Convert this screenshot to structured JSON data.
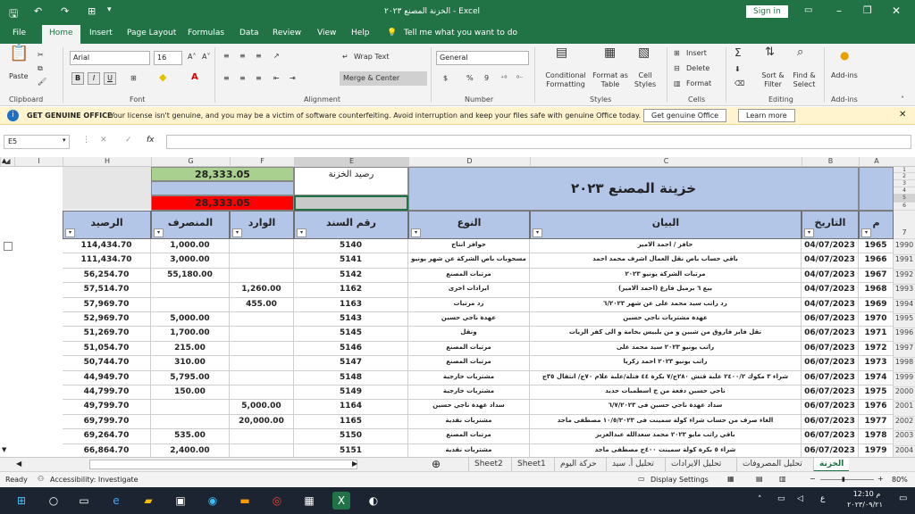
{
  "window": {
    "title": "الخزنة المصنع ٢٠٢٣ - Excel",
    "signin": "Sign in"
  },
  "menu": {
    "items": [
      "File",
      "Home",
      "Insert",
      "Page Layout",
      "Formulas",
      "Data",
      "Review",
      "View",
      "Help"
    ],
    "tellme": "Tell me what you want to do"
  },
  "ribbon": {
    "clipboard": {
      "paste": "Paste",
      "label": "Clipboard"
    },
    "font": {
      "name": "Arial",
      "size": "16",
      "bold": "B",
      "italic": "I",
      "underline": "U",
      "label": "Font"
    },
    "alignment": {
      "wrap": "Wrap Text",
      "merge": "Merge & Center",
      "label": "Alignment"
    },
    "number": {
      "format": "General",
      "currency": "$",
      "percent": "%",
      "comma": "9",
      "label": "Number"
    },
    "styles": {
      "conditional": "Conditional Formatting",
      "format_table": "Format as Table",
      "cell_styles": "Cell Styles",
      "label": "Styles"
    },
    "cells": {
      "insert": "Insert",
      "delete": "Delete",
      "format": "Format",
      "label": "Cells"
    },
    "editing": {
      "sum": "Σ",
      "sort": "Sort & Filter",
      "find": "Find & Select",
      "label": "Editing"
    },
    "addins": {
      "btn": "Add-ins",
      "label": "Add-ins"
    }
  },
  "message": {
    "title": "GET GENUINE OFFICE",
    "text": "Your license isn't genuine, and you may be a victim of software counterfeiting. Avoid interruption and keep your files safe with genuine Office today.",
    "btn1": "Get genuine Office",
    "btn2": "Learn more"
  },
  "formula": {
    "namebox": "E5",
    "value": ""
  },
  "columns": [
    "I",
    "H",
    "G",
    "F",
    "E",
    "D",
    "C",
    "B",
    "A"
  ],
  "top": {
    "balance_g": "28,333.05",
    "label_e": "رصيد الخزنة",
    "title_c": "خزينة المصنع ٢٠٢٣",
    "red_g": "28,333.05"
  },
  "row_headers_top": [
    "1",
    "2",
    "3",
    "4",
    "5",
    "6",
    "7"
  ],
  "headers": {
    "h": "الرصيد",
    "g": "المنصرف",
    "f": "الوارد",
    "e": "رقم السند",
    "d": "النوع",
    "c": "البيان",
    "b": "التاريخ",
    "a": "م"
  },
  "rows": [
    {
      "rn": "1990",
      "a": "1965",
      "b": "04/07/2023",
      "c": "حافز / احمد الامير",
      "d": "حوافز انتاج",
      "e": "5140",
      "f": "",
      "g": "1,000.00",
      "h": "114,434.70"
    },
    {
      "rn": "1991",
      "a": "1966",
      "b": "04/07/2023",
      "c": "باقي حساب باص نقل العمال اشرف محمد احمد",
      "d": "مسحوبات باص الشركة عن شهر يونيو",
      "e": "5141",
      "f": "",
      "g": "3,000.00",
      "h": "111,434.70"
    },
    {
      "rn": "1992",
      "a": "1967",
      "b": "04/07/2023",
      "c": "مرتبات الشركة يونيو ٢٠٢٣",
      "d": "مرتبات المصنع",
      "e": "5142",
      "f": "",
      "g": "55,180.00",
      "h": "56,254.70"
    },
    {
      "rn": "1993",
      "a": "1968",
      "b": "04/07/2023",
      "c": "بيع ٦ برميل فارغ (احمد الامير)",
      "d": "ايرادات اخرى",
      "e": "1162",
      "f": "1,260.00",
      "g": "",
      "h": "57,514.70"
    },
    {
      "rn": "1994",
      "a": "1969",
      "b": "04/07/2023",
      "c": "رد راتب سيد محمد على عن شهر ٦/٢٠٢٣",
      "d": "رد مرتبات",
      "e": "1163",
      "f": "455.00",
      "g": "",
      "h": "57,969.70"
    },
    {
      "rn": "1995",
      "a": "1970",
      "b": "06/07/2023",
      "c": "عهدة مشتريات ناجي حسين",
      "d": "عهدة ناجي حسين",
      "e": "5143",
      "f": "",
      "g": "5,000.00",
      "h": "52,969.70"
    },
    {
      "rn": "1996",
      "a": "1971",
      "b": "06/07/2023",
      "c": "نقل فايز فاروق من شبين و من بلبيس بخامة و الى كفر الزيات",
      "d": "ونقل",
      "e": "5145",
      "f": "",
      "g": "1,700.00",
      "h": "51,269.70"
    },
    {
      "rn": "1997",
      "a": "1972",
      "b": "06/07/2023",
      "c": "راتب يونيو ٢٠٢٣ سيد محمد على",
      "d": "مرتبات المصنع",
      "e": "5146",
      "f": "",
      "g": "215.00",
      "h": "51,054.70"
    },
    {
      "rn": "1998",
      "a": "1973",
      "b": "06/07/2023",
      "c": "راتب يونيو ٢٠٢٣ احمد زكريا",
      "d": "مرتبات المصنع",
      "e": "5147",
      "f": "",
      "g": "310.00",
      "h": "50,744.70"
    },
    {
      "rn": "1999",
      "a": "1974",
      "b": "06/07/2023",
      "c": "شراء ٣ مكوك ٢٤٠٠/٢ علبة قتش ٢٨٠ج/٧ بكرة ٤٤ فتلة/علبة علام ٧٠ج/ انتقال ٣٥ج",
      "d": "مشتريات خارجية",
      "e": "5148",
      "f": "",
      "g": "5,795.00",
      "h": "44,949.70"
    },
    {
      "rn": "2000",
      "a": "1975",
      "b": "06/07/2023",
      "c": "ناجي حسين دفعة من ح اسطمبات حديد",
      "d": "مشتريات خارجية",
      "e": "5149",
      "f": "",
      "g": "150.00",
      "h": "44,799.70"
    },
    {
      "rn": "2001",
      "a": "1976",
      "b": "06/07/2023",
      "c": "سداد عهدة ناجي حسين فى ٦/٧/٢٠٢٣",
      "d": "سداد عهدة ناجي حسين",
      "e": "1164",
      "f": "5,000.00",
      "g": "",
      "h": "49,799.70"
    },
    {
      "rn": "2002",
      "a": "1977",
      "b": "06/07/2023",
      "c": "الغاء صرف من حساب شراء كولة سمينت فى ١٠/٥/٢٠٢٣ مصطفى ماجد",
      "d": "مشتريات نقدية",
      "e": "1165",
      "f": "20,000.00",
      "g": "",
      "h": "69,799.70"
    },
    {
      "rn": "2003",
      "a": "1978",
      "b": "06/07/2023",
      "c": "باقي راتب مايو ٢٠٢٣ محمد سعدالله عبدالعزيز",
      "d": "مرتبات المصنع",
      "e": "5150",
      "f": "",
      "g": "535.00",
      "h": "69,264.70"
    },
    {
      "rn": "2004",
      "a": "1979",
      "b": "06/07/2023",
      "c": "شراء ٥ بكرة كولة سمينت ٤٠٠ج مصطفى ماجد",
      "d": "مشتريات نقدية",
      "e": "5151",
      "f": "",
      "g": "2,400.00",
      "h": "66,864.70"
    }
  ],
  "tabs": [
    "الخزنة",
    "تحليل المصروفات",
    "تحليل الايرادات",
    "تحليل أ. سيد",
    "حركة اليوم",
    "Sheet1",
    "Sheet2"
  ],
  "status": {
    "ready": "Ready",
    "accessibility": "Accessibility: Investigate",
    "display": "Display Settings",
    "zoom": "80%"
  },
  "taskbar": {
    "time": "12:10 م",
    "date": "٢٠٢٣/٠٩/٢١",
    "lang": "ع"
  }
}
